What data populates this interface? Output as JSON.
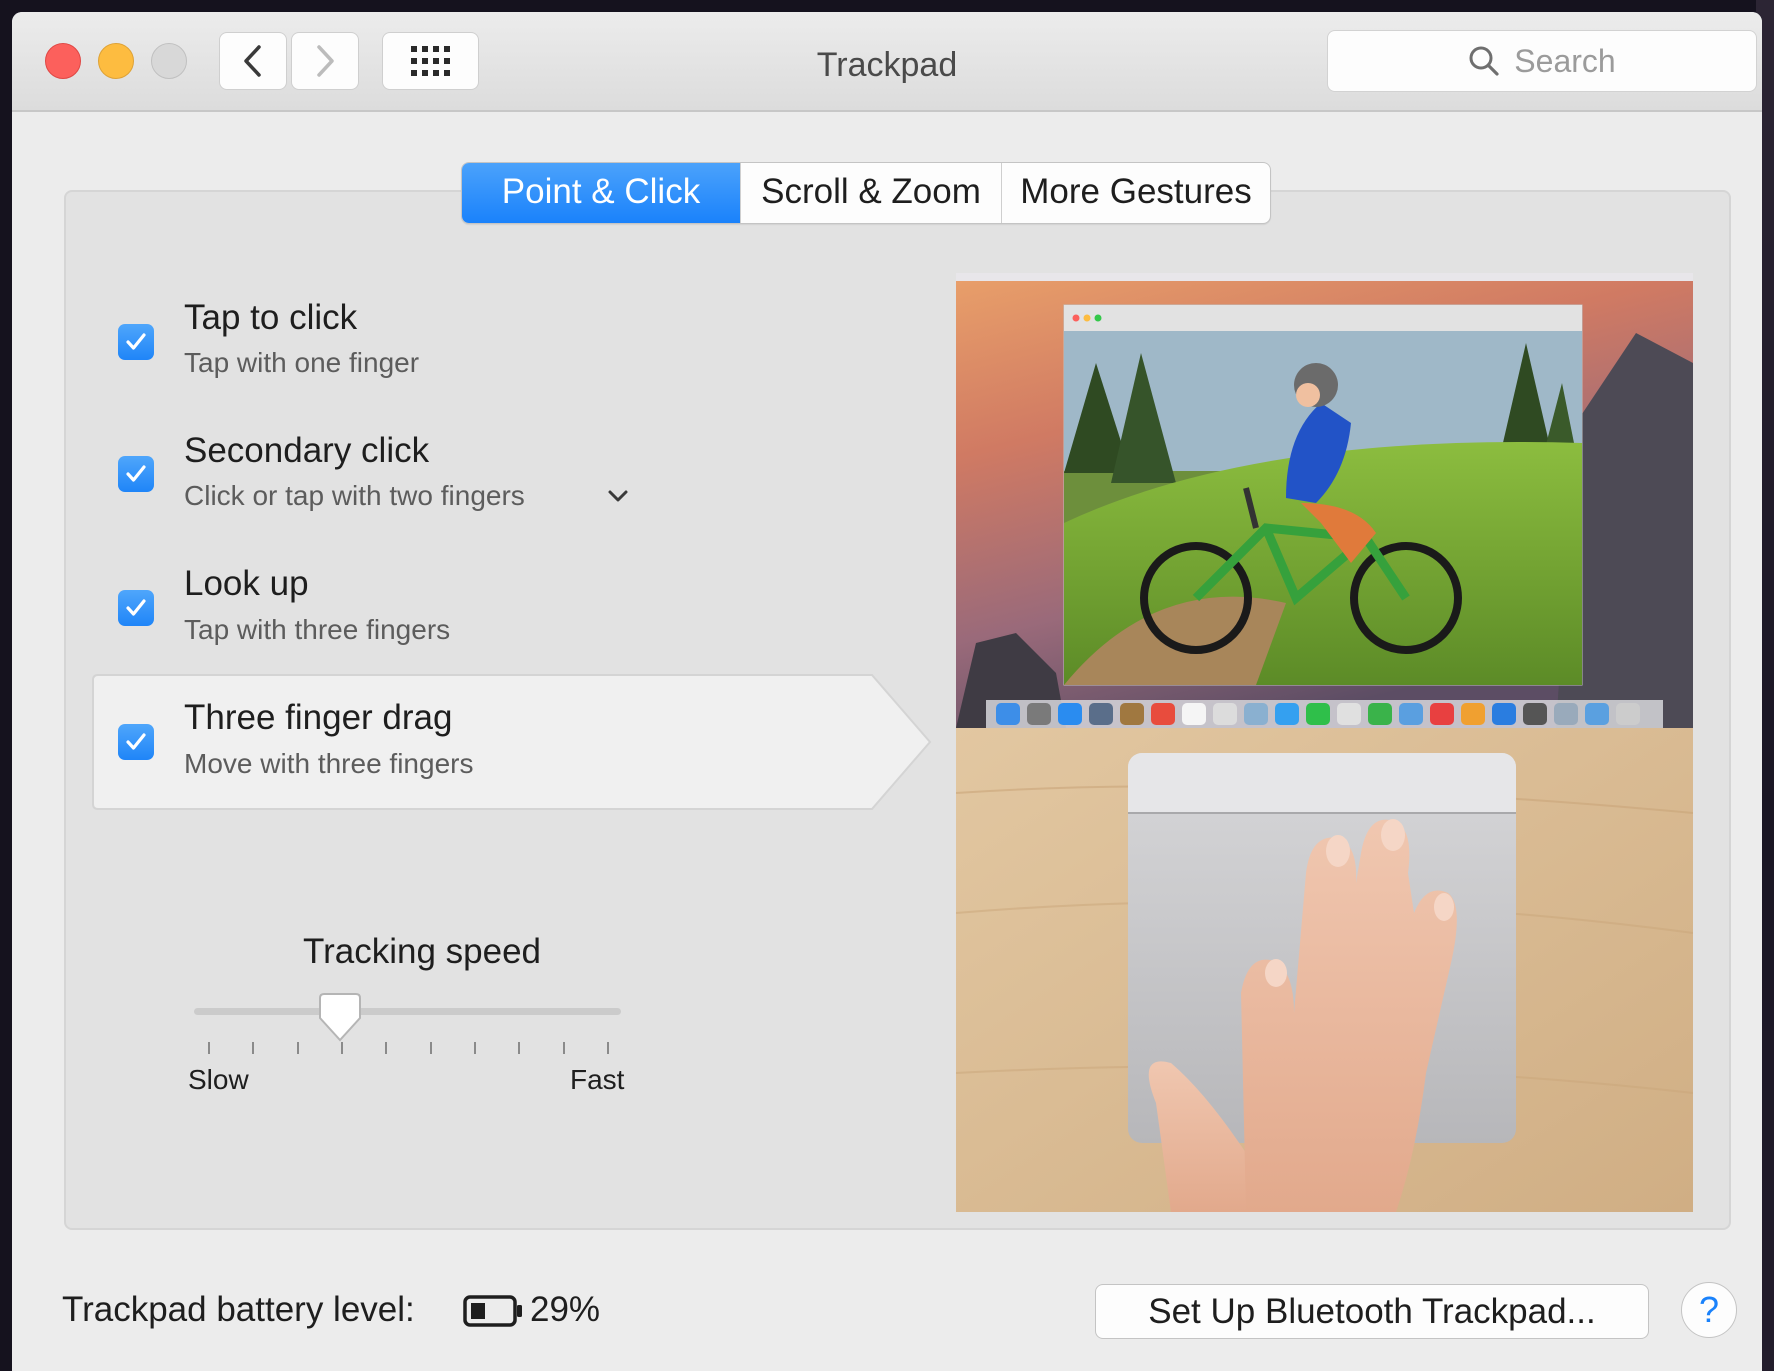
{
  "window": {
    "title": "Trackpad"
  },
  "toolbar": {
    "search_placeholder": "Search"
  },
  "tabs": [
    {
      "label": "Point & Click",
      "active": true
    },
    {
      "label": "Scroll & Zoom",
      "active": false
    },
    {
      "label": "More Gestures",
      "active": false
    }
  ],
  "options": [
    {
      "title": "Tap to click",
      "subtitle": "Tap with one finger",
      "checked": true
    },
    {
      "title": "Secondary click",
      "subtitle": "Click or tap with two fingers",
      "checked": true,
      "has_menu": true
    },
    {
      "title": "Look up",
      "subtitle": "Tap with three fingers",
      "checked": true
    },
    {
      "title": "Three finger drag",
      "subtitle": "Move with three fingers",
      "checked": true,
      "selected": true
    }
  ],
  "tracking": {
    "title": "Tracking speed",
    "min_label": "Slow",
    "max_label": "Fast",
    "value_fraction": 0.33,
    "tick_count": 10
  },
  "footer": {
    "battery_label": "Trackpad battery level:",
    "battery_percent": "29%",
    "setup_button": "Set Up Bluetooth Trackpad...",
    "help_button": "?"
  },
  "colors": {
    "accent": "#1a82fb",
    "close": "#fc605c",
    "minimize": "#fdbc40",
    "zoom_disabled": "#d8d8d8"
  }
}
